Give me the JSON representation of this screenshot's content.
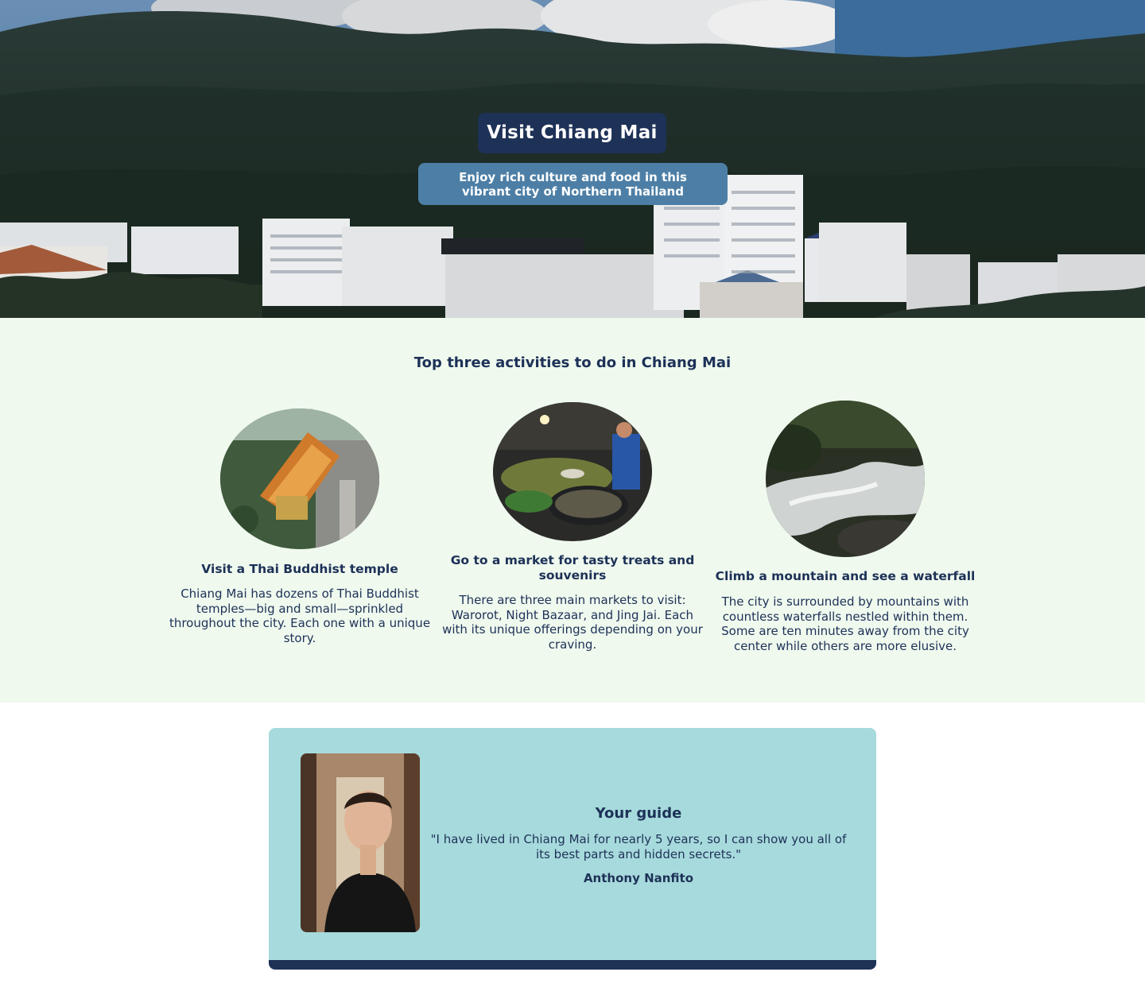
{
  "hero": {
    "title": "Visit Chiang Mai",
    "subtitle": "Enjoy rich culture and food in this vibrant city of Northern Thailand"
  },
  "activities": {
    "heading": "Top three activities to do in Chiang Mai",
    "items": [
      {
        "title": "Visit a Thai Buddhist temple",
        "description": "Chiang Mai has dozens of Thai Buddhist temples—big and small—sprinkled throughout the city. Each one with a unique story.",
        "image": "temple-photo"
      },
      {
        "title": "Go to a market for tasty treats and souvenirs",
        "description": "There are three main markets to visit: Warorot, Night Bazaar, and Jing Jai. Each with its unique offerings depending on your craving.",
        "image": "market-photo"
      },
      {
        "title": "Climb a mountain and see a waterfall",
        "description": "The city is surrounded by mountains with countless waterfalls nestled within them. Some are ten minutes away from the city center while others are more elusive.",
        "image": "waterfall-photo"
      }
    ]
  },
  "guide": {
    "heading": "Your guide",
    "quote": "\"I have lived in Chiang Mai for nearly 5 years, so I can show you all of its best parts and hidden secrets.\"",
    "name": "Anthony Nanfito"
  },
  "colors": {
    "navy": "#1e3156",
    "subtitle_bg": "#4d7fa6",
    "activities_bg": "#eff9ee",
    "guide_bg": "#a7dadc",
    "text": "#1d3157"
  }
}
